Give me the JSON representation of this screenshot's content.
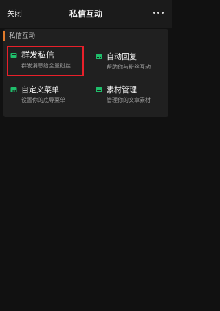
{
  "nav": {
    "close_label": "关闭",
    "title": "私信互动"
  },
  "section": {
    "title": "私信互动"
  },
  "items": [
    {
      "title": "群发私信",
      "desc": "群发消息给全量粉丝",
      "icon": "message-list-icon"
    },
    {
      "title": "自动回复",
      "desc": "帮助你与粉丝互动",
      "icon": "auto-reply-icon"
    },
    {
      "title": "自定义菜单",
      "desc": "设置你的底导菜单",
      "icon": "menu-icon"
    },
    {
      "title": "素材管理",
      "desc": "管理你的文章素材",
      "icon": "material-icon"
    }
  ],
  "colors": {
    "accent_green": "#1fbf6b",
    "section_bar": "#e07a2b",
    "highlight": "#e8202a"
  }
}
